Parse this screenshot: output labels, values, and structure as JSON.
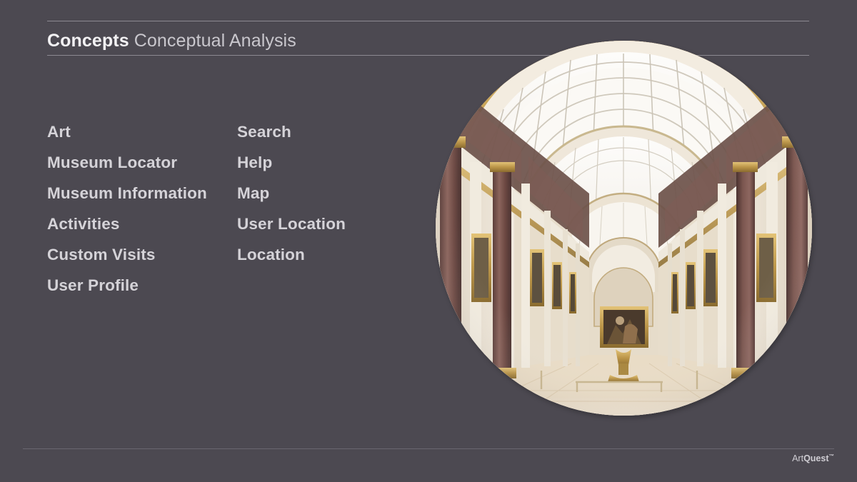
{
  "header": {
    "title_main": "Concepts",
    "title_sub": "Conceptual Analysis"
  },
  "concepts": {
    "left_column": [
      {
        "label": "Art"
      },
      {
        "label": "Museum Locator"
      },
      {
        "label": "Museum Information"
      },
      {
        "label": "Activities"
      },
      {
        "label": "Custom Visits"
      },
      {
        "label": "User Profile"
      }
    ],
    "right_column": [
      {
        "label": "Search"
      },
      {
        "label": "Help"
      },
      {
        "label": "Map"
      },
      {
        "label": "User Location"
      },
      {
        "label": "Location"
      }
    ]
  },
  "media": {
    "photo": {
      "name": "museum-gallery-photo",
      "shape": "circle",
      "description": "Grand museum gallery hall with barrel-vaulted glass skylight, marble columns and framed paintings"
    }
  },
  "footer": {
    "logo_part1": "Art",
    "logo_part2": "Quest",
    "logo_tm": "™"
  },
  "colors": {
    "background": "#4C4951",
    "rule": "#8D8A92",
    "footer_rule": "#696670",
    "title_main": "#F2F1F3",
    "title_sub": "#C9C7CD",
    "item_text": "#D5D3D8"
  }
}
